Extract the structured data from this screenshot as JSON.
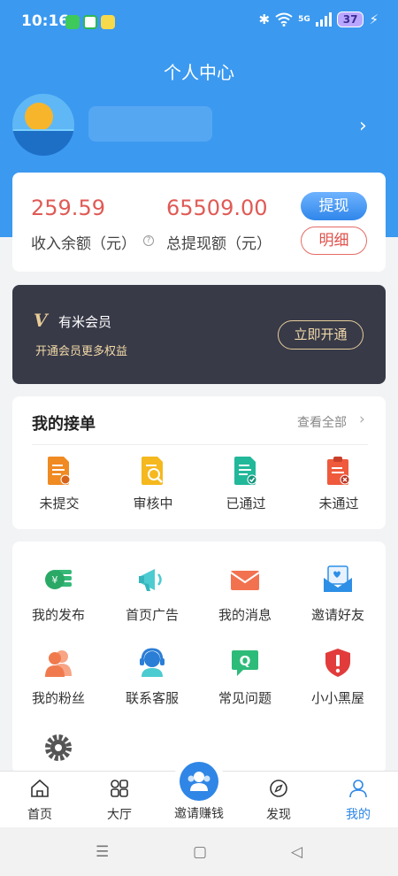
{
  "status_bar": {
    "time": "10:16",
    "signal_label": "5G",
    "battery": "37",
    "charging_icon": "⚡"
  },
  "header": {
    "title": "个人中心",
    "chevron": "›"
  },
  "earnings": {
    "balance_value": "259.59",
    "balance_label": "收入余额（元）",
    "withdrawn_value": "65509.00",
    "withdrawn_label": "总提现额（元）",
    "withdraw_button": "提现",
    "detail_button": "明细",
    "accent_color": "#e05a55"
  },
  "membership": {
    "logo": "V",
    "title": "有米会员",
    "subtitle": "开通会员更多权益",
    "button": "立即开通"
  },
  "orders": {
    "title": "我的接单",
    "view_all": "查看全部",
    "chevron": "›",
    "items": [
      {
        "label": "未提交",
        "icon": "doc-pending-icon"
      },
      {
        "label": "审核中",
        "icon": "doc-review-icon"
      },
      {
        "label": "已通过",
        "icon": "doc-approved-icon"
      },
      {
        "label": "未通过",
        "icon": "doc-rejected-icon"
      }
    ]
  },
  "tools": {
    "items": [
      {
        "label": "我的发布",
        "icon": "coins-icon"
      },
      {
        "label": "首页广告",
        "icon": "megaphone-icon"
      },
      {
        "label": "我的消息",
        "icon": "envelope-icon"
      },
      {
        "label": "邀请好友",
        "icon": "invite-letter-icon"
      },
      {
        "label": "我的粉丝",
        "icon": "fans-icon"
      },
      {
        "label": "联系客服",
        "icon": "customer-service-icon"
      },
      {
        "label": "常见问题",
        "icon": "faq-icon"
      },
      {
        "label": "小小黑屋",
        "icon": "shield-alert-icon"
      },
      {
        "label": "",
        "icon": "settings-gear-icon"
      }
    ]
  },
  "tabbar": {
    "home": "首页",
    "hall": "大厅",
    "invite": "邀请赚钱",
    "discover": "发现",
    "mine": "我的",
    "active_color": "#2c86e6"
  },
  "system_nav": {
    "menu": "☰",
    "home": "▢",
    "back": "◁"
  }
}
